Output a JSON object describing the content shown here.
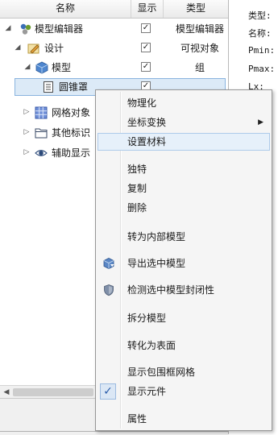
{
  "tree": {
    "columns": [
      "名称",
      "显示",
      "类型"
    ],
    "rows": [
      {
        "label": "模型编辑器",
        "type": "模型编辑器",
        "shown": "✓"
      },
      {
        "label": "设计",
        "type": "可视对象",
        "shown": "✓"
      },
      {
        "label": "模型",
        "type": "组",
        "shown": "✓"
      },
      {
        "label": "圆锥罩",
        "type": "",
        "shown": "✓"
      },
      {
        "label": "网格对象",
        "type": "",
        "shown": ""
      },
      {
        "label": "其他标识",
        "type": "",
        "shown": ""
      },
      {
        "label": "辅助显示",
        "type": "",
        "shown": ""
      }
    ]
  },
  "props": {
    "type_label": "类型:",
    "name_label": "名称:",
    "pmin_label": "Pmin:",
    "pmax_label": "Pmax:",
    "lx_label": "Lx:"
  },
  "menu": {
    "items": [
      {
        "label": "物理化"
      },
      {
        "label": "坐标变换",
        "submenu_glyph": "▶"
      },
      {
        "label": "设置材料"
      },
      {
        "label": "独特"
      },
      {
        "label": "复制"
      },
      {
        "label": "删除"
      },
      {
        "label": "转为内部模型"
      },
      {
        "label": "导出选中模型"
      },
      {
        "label": "检测选中模型封闭性"
      },
      {
        "label": "拆分模型"
      },
      {
        "label": "转化为表面"
      },
      {
        "label": "显示包围框网格"
      },
      {
        "label": "显示元件",
        "checked": "✓"
      },
      {
        "label": "属性"
      }
    ]
  },
  "colors": {
    "selection_bg": "#dceaf7",
    "menu_hover_bg": "#e6f0fa",
    "accent_blue": "#2a5caa"
  }
}
